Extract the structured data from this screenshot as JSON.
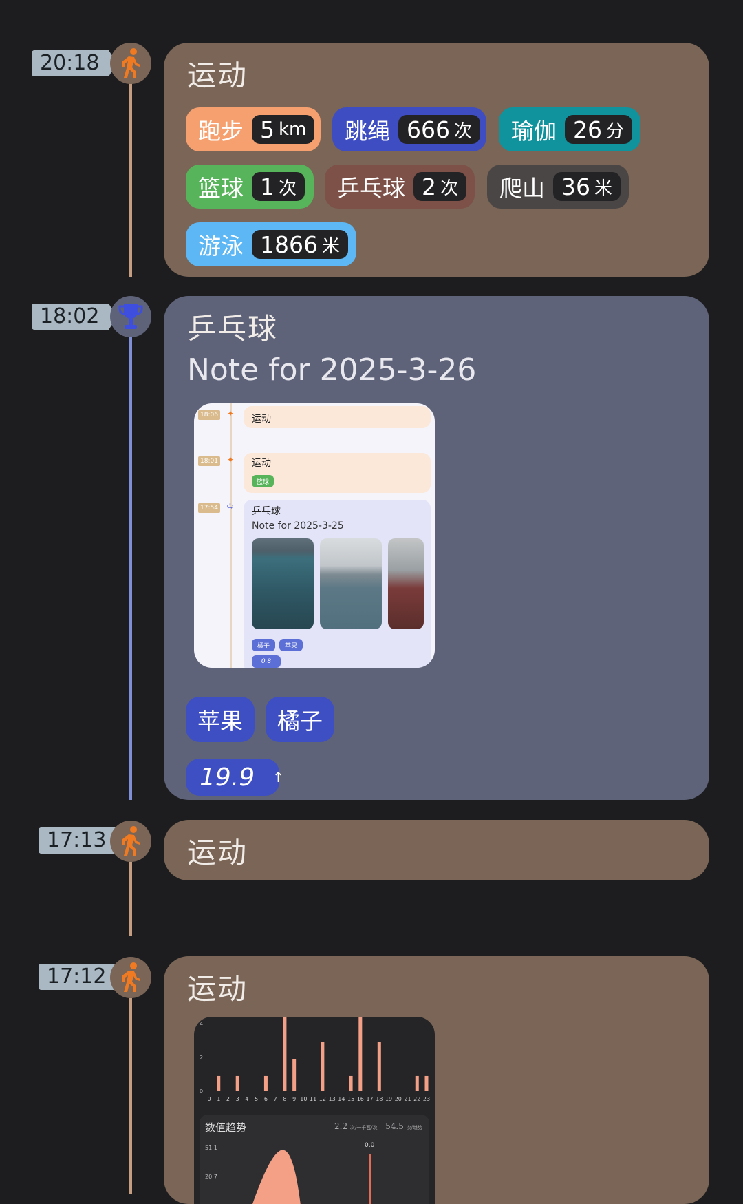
{
  "colors": {
    "background": "#1d1d1f",
    "sport_card": "#7a6556",
    "note_card": "#5e6379",
    "accent_orange": "#f07a22",
    "tag_blue": "#3e4fc4"
  },
  "timeline": [
    {
      "time": "20:18",
      "icon": "running-person-icon",
      "title": "运动",
      "chips": [
        {
          "label": "跑步",
          "value": "5",
          "unit": "km",
          "color": "#f6a06f"
        },
        {
          "label": "跳绳",
          "value": "666",
          "unit": "次",
          "color": "#3f4dc2"
        },
        {
          "label": "瑜伽",
          "value": "26",
          "unit": "分",
          "color": "#10939c"
        },
        {
          "label": "篮球",
          "value": "1",
          "unit": "次",
          "color": "#58b45a"
        },
        {
          "label": "乒乓球",
          "value": "2",
          "unit": "次",
          "color": "#7d5148"
        },
        {
          "label": "爬山",
          "value": "36",
          "unit": "米",
          "color": "#4b4646"
        },
        {
          "label": "游泳",
          "value": "1866",
          "unit": "米",
          "color": "#5db7f5"
        }
      ]
    },
    {
      "time": "18:02",
      "icon": "trophy-icon",
      "title": "乒乓球",
      "note": "Note for 2025-3-26",
      "tags": [
        "苹果",
        "橘子"
      ],
      "value": "19.9",
      "value_arrow": "↑",
      "embedded_screenshot": {
        "items": [
          {
            "time": "18:06",
            "title": "运动"
          },
          {
            "time": "18:01",
            "title": "运动",
            "tags": [
              "篮球"
            ]
          },
          {
            "time": "17:54",
            "title": "乒乓球",
            "note": "Note for 2025-3-25",
            "tags": [
              "橘子",
              "苹果"
            ],
            "value": "0.8"
          }
        ]
      }
    },
    {
      "time": "17:13",
      "icon": "running-person-icon",
      "title": "运动"
    },
    {
      "time": "17:12",
      "icon": "running-person-icon",
      "title": "运动",
      "chart_data": [
        {
          "type": "bar",
          "categories": [
            "0",
            "1",
            "2",
            "3",
            "4",
            "5",
            "6",
            "7",
            "8",
            "9",
            "10",
            "11",
            "12",
            "13",
            "14",
            "15",
            "16",
            "17",
            "18",
            "19",
            "20",
            "21",
            "22",
            "23"
          ],
          "values": [
            0,
            0.9,
            0,
            0.9,
            0,
            0,
            0.9,
            0,
            4.5,
            1.9,
            0,
            0,
            2.9,
            0,
            0,
            0.9,
            4.5,
            0,
            2.9,
            0,
            0,
            0,
            0.9,
            0.9
          ],
          "ylim": [
            0,
            4
          ],
          "yticks": [
            "0",
            "2",
            "4"
          ]
        },
        {
          "type": "area",
          "title": "数值趋势",
          "stats": [
            {
              "value": "2.2",
              "label": "次/一千瓦/次"
            },
            {
              "value": "54.5",
              "label": "次/趋势"
            }
          ],
          "yticks": [
            "51.1",
            "20.7"
          ],
          "marker_label": "0.0"
        }
      ]
    }
  ]
}
